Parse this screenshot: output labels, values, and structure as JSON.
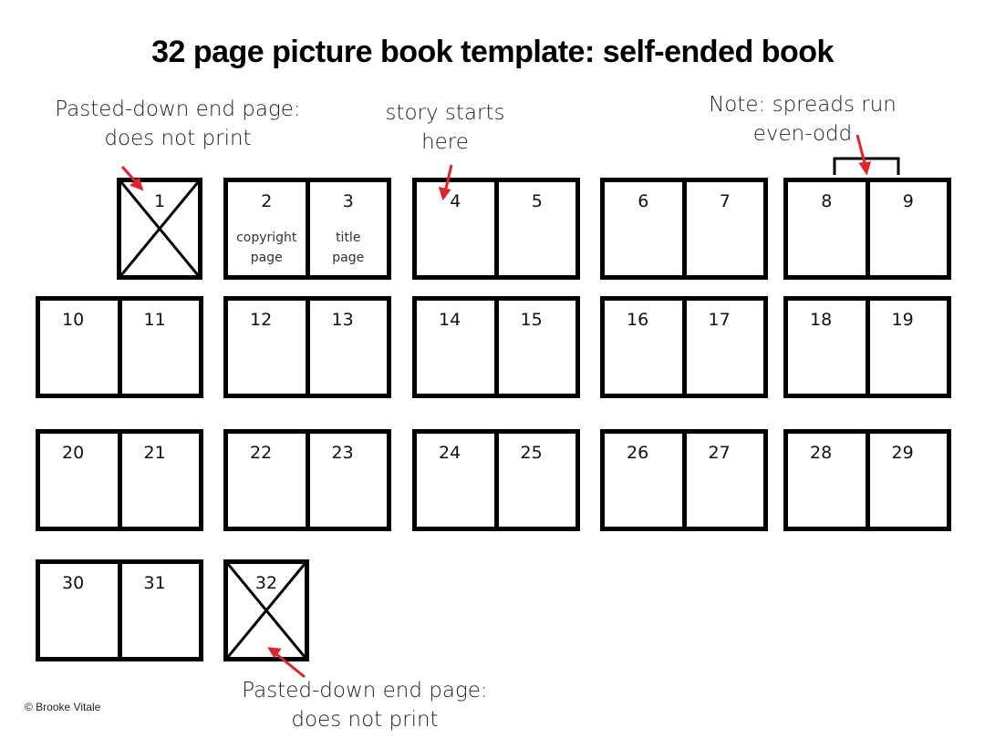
{
  "title": "32 page picture book template: self-ended book",
  "annotations": {
    "front_endpaper": [
      "Pasted-down end page:",
      "does not print"
    ],
    "story_start": [
      "story starts",
      "here"
    ],
    "spread_note": [
      "Note: spreads run",
      "even-odd"
    ],
    "back_endpaper": [
      "Pasted-down end page:",
      "does not print"
    ]
  },
  "colors": {
    "arrow": "#e0242a",
    "line": "#000000"
  },
  "rows": [
    {
      "spreads": [
        {
          "pages": [
            {
              "num": "1",
              "crossed": true
            }
          ]
        },
        {
          "pages": [
            {
              "num": "2",
              "label": [
                "copyright",
                "page"
              ]
            },
            {
              "num": "3",
              "label": [
                "title",
                "page"
              ]
            }
          ]
        },
        {
          "pages": [
            {
              "num": "4"
            },
            {
              "num": "5"
            }
          ]
        },
        {
          "pages": [
            {
              "num": "6"
            },
            {
              "num": "7"
            }
          ]
        },
        {
          "pages": [
            {
              "num": "8"
            },
            {
              "num": "9"
            }
          ]
        }
      ]
    },
    {
      "spreads": [
        {
          "pages": [
            {
              "num": "10"
            },
            {
              "num": "11"
            }
          ]
        },
        {
          "pages": [
            {
              "num": "12"
            },
            {
              "num": "13"
            }
          ]
        },
        {
          "pages": [
            {
              "num": "14"
            },
            {
              "num": "15"
            }
          ]
        },
        {
          "pages": [
            {
              "num": "16"
            },
            {
              "num": "17"
            }
          ]
        },
        {
          "pages": [
            {
              "num": "18"
            },
            {
              "num": "19"
            }
          ]
        }
      ]
    },
    {
      "spreads": [
        {
          "pages": [
            {
              "num": "20"
            },
            {
              "num": "21"
            }
          ]
        },
        {
          "pages": [
            {
              "num": "22"
            },
            {
              "num": "23"
            }
          ]
        },
        {
          "pages": [
            {
              "num": "24"
            },
            {
              "num": "25"
            }
          ]
        },
        {
          "pages": [
            {
              "num": "26"
            },
            {
              "num": "27"
            }
          ]
        },
        {
          "pages": [
            {
              "num": "28"
            },
            {
              "num": "29"
            }
          ]
        }
      ]
    },
    {
      "spreads": [
        {
          "pages": [
            {
              "num": "30"
            },
            {
              "num": "31"
            }
          ]
        },
        {
          "pages": [
            {
              "num": "32",
              "crossed": true
            }
          ]
        }
      ]
    }
  ],
  "copyright": "© Brooke Vitale"
}
